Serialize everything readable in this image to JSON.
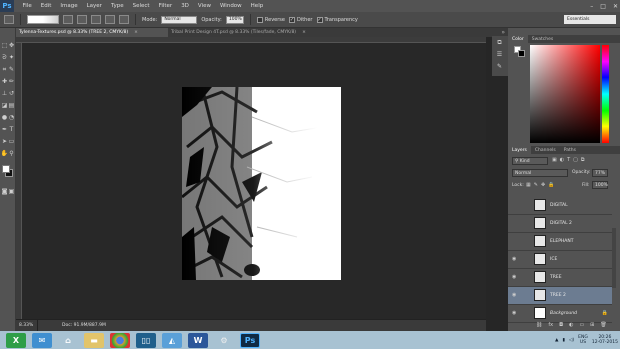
{
  "app": {
    "logo": "Ps"
  },
  "menu": [
    "File",
    "Edit",
    "Image",
    "Layer",
    "Type",
    "Select",
    "Filter",
    "3D",
    "View",
    "Window",
    "Help"
  ],
  "window_controls": {
    "minimize": "–",
    "maximize": "□",
    "close": "✕"
  },
  "options": {
    "mode_label": "Mode:",
    "mode_value": "Normal",
    "opacity_label": "Opacity:",
    "opacity_value": "100%",
    "reverse_label": "Reverse",
    "dither_label": "Dither",
    "transparency_label": "Transparency",
    "workspace": "Essentials"
  },
  "tabs": [
    {
      "label": "Tylenna-Textures.psd @ 8.33% (TREE 2, CMYK/8)",
      "close": "×"
    },
    {
      "label": "Tribal Print Design 4T.psd @ 8.33% (Tiles/fade, CMYK/8)",
      "close": "×"
    }
  ],
  "status": {
    "zoom": "8.33%",
    "doc": "Doc: 91.9M/887.9M"
  },
  "color_panel": {
    "tabs": [
      "Color",
      "Swatches"
    ]
  },
  "layers_panel": {
    "tabs": [
      "Layers",
      "Channels",
      "Paths"
    ],
    "filter_kind": "Kind",
    "blend_mode": "Normal",
    "opacity_label": "Opacity:",
    "opacity_value": "77%",
    "lock_label": "Lock:",
    "fill_label": "Fill:",
    "fill_value": "100%",
    "layers": [
      {
        "name": "DIGITAL",
        "visible": false,
        "selected": false
      },
      {
        "name": "DIGITAL 2",
        "visible": false,
        "selected": false
      },
      {
        "name": "ELEPHANT",
        "visible": false,
        "selected": false
      },
      {
        "name": "ICE",
        "visible": true,
        "selected": false
      },
      {
        "name": "TREE",
        "visible": true,
        "selected": false
      },
      {
        "name": "TREE 2",
        "visible": true,
        "selected": true
      },
      {
        "name": "Background",
        "visible": true,
        "selected": false
      }
    ]
  },
  "taskbar": {
    "tray": {
      "lang": "ENG",
      "region": "US",
      "time": "20:26",
      "date": "12-07-2015"
    }
  },
  "colors": {
    "accent_selected": "#6c7c91",
    "taskbar": "#a8c2d2",
    "ps_logo": "#4fb3ff"
  }
}
